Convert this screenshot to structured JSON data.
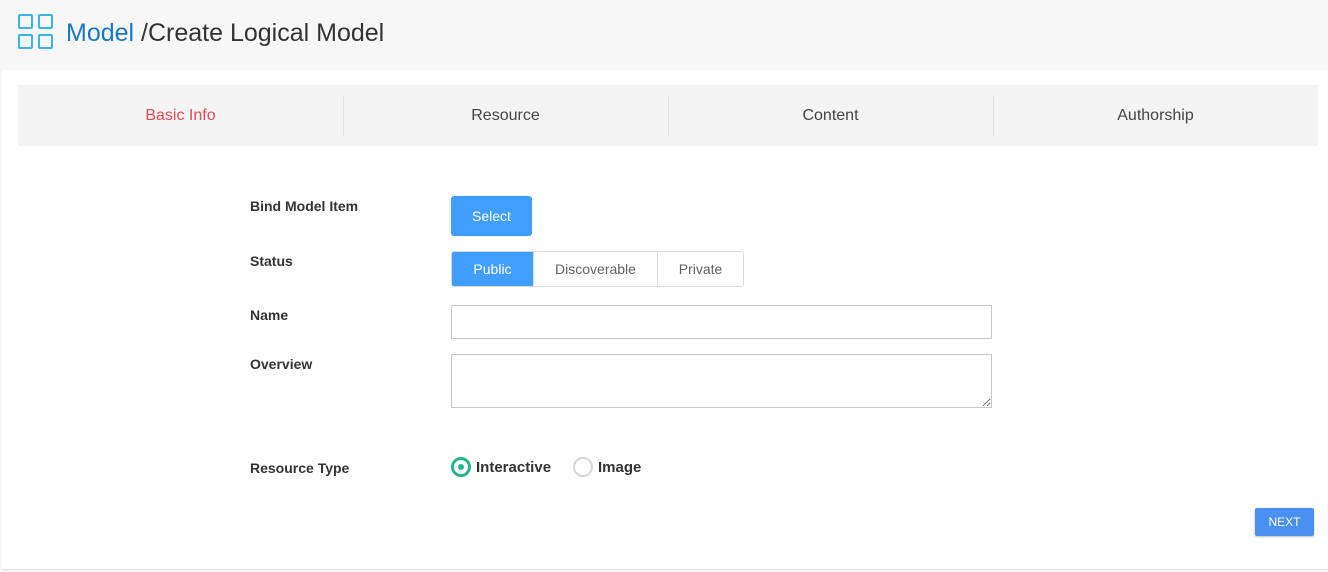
{
  "header": {
    "icon": "grid-icon",
    "title_root": "Model",
    "title_rest": " /Create Logical Model"
  },
  "steps": [
    {
      "label": "Basic Info",
      "active": true
    },
    {
      "label": "Resource",
      "active": false
    },
    {
      "label": "Content",
      "active": false
    },
    {
      "label": "Authorship",
      "active": false
    }
  ],
  "form": {
    "bind_label": "Bind Model Item",
    "select_button": "Select",
    "status_label": "Status",
    "status_options": [
      "Public",
      "Discoverable",
      "Private"
    ],
    "status_selected": "Public",
    "name_label": "Name",
    "name_value": "",
    "overview_label": "Overview",
    "overview_value": "",
    "resource_type_label": "Resource Type",
    "resource_types": [
      "Interactive",
      "Image"
    ],
    "resource_type_selected": "Interactive"
  },
  "actions": {
    "next_label": "NEXT"
  },
  "colors": {
    "accent": "#409eff",
    "active_step": "#e04b55",
    "title_link": "#1a78c2",
    "radio_on": "#26b68f"
  }
}
